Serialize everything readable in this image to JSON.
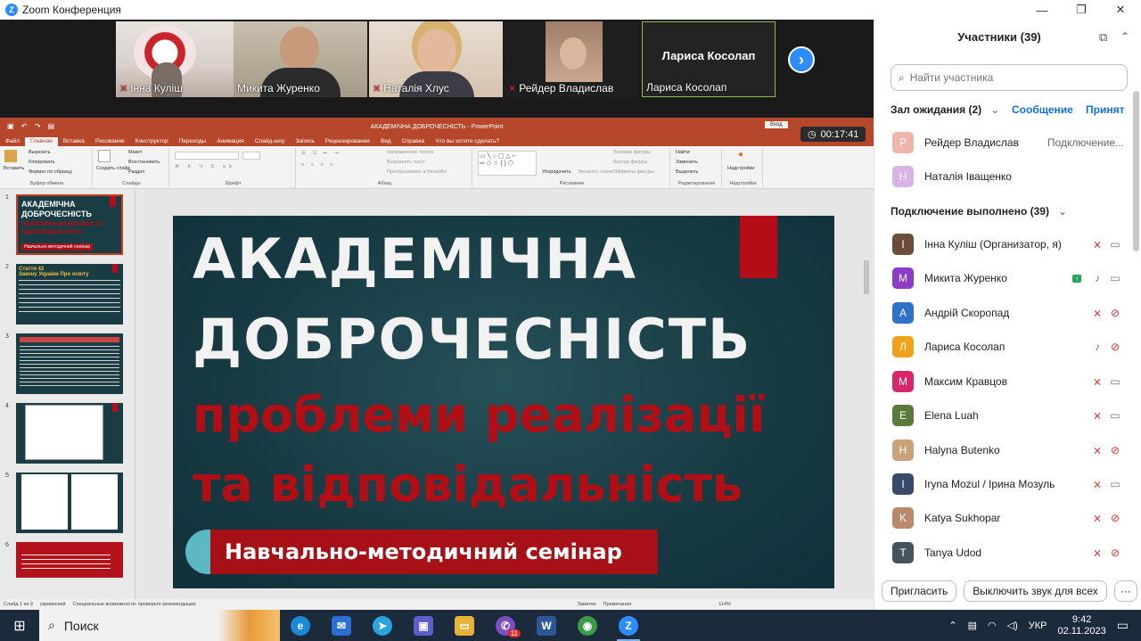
{
  "window": {
    "title": "Zoom Конференция",
    "minimize_icon": "—",
    "maximize_icon": "❐",
    "close_icon": "✕"
  },
  "video_strip": {
    "tiles": [
      {
        "name": "Інна Куліш",
        "muted": true
      },
      {
        "name": "Микита Журенко",
        "muted": false
      },
      {
        "name": "Наталія Хлус",
        "muted": true
      },
      {
        "name": "Рейдер Владислав",
        "muted": true
      },
      {
        "name": "Лариса Косолап",
        "muted": false,
        "big_label": "Лариса Косолап"
      }
    ],
    "next_icon": "›"
  },
  "timer": "00:17:41",
  "powerpoint": {
    "title": "АКАДЕМІЧНА ДОБРОЧЕСНІСТЬ - PowerPoint",
    "signin": "Вход",
    "menu": [
      "Файл",
      "Главная",
      "Вставка",
      "Рисование",
      "Конструктор",
      "Переходы",
      "Анимация",
      "Слайд-шоу",
      "Запись",
      "Рецензирование",
      "Вид",
      "Справка",
      "Что вы хотите сделать?"
    ],
    "active_menu": "Главная",
    "ribbon": {
      "clipboard": {
        "paste": "Вставить",
        "cut": "Вырезать",
        "copy": "Копировать",
        "format": "Формат по образцу",
        "label": "Буфер обмена"
      },
      "slides": {
        "new": "Создать слайд",
        "layout": "Макет",
        "reset": "Восстановить",
        "section": "Раздел",
        "label": "Слайды"
      },
      "font_label": "Шрифт",
      "paragraph": {
        "direction": "Направление текста",
        "align": "Выровнять текст",
        "smartart": "Преобразовать в SmartArt",
        "label": "Абзац"
      },
      "drawing": {
        "arrange": "Упорядочить",
        "styles": "Экспресс-стили",
        "fill": "Заливка фигуры",
        "outline": "Контур фигуры",
        "effects": "Эффекты фигуры",
        "label": "Рисование"
      },
      "editing": {
        "find": "Найти",
        "replace": "Заменить",
        "select": "Выделить",
        "label": "Редактирование"
      },
      "addins": {
        "addins": "Надстройки",
        "label": "Надстройки"
      }
    },
    "thumbnails": [
      {
        "num": "1",
        "title": "АКАДЕМІЧНА ДОБРОЧЕСНІСТЬ",
        "sub": "проблеми реалізації та відповідальність",
        "band": "Навчально-методичний семінар"
      },
      {
        "num": "2",
        "title": "Стаття 42",
        "sub": "Закону України Про освіту"
      },
      {
        "num": "3"
      },
      {
        "num": "4"
      },
      {
        "num": "5"
      },
      {
        "num": "6"
      }
    ],
    "slide": {
      "line1": "АКАДЕМІЧНА",
      "line2": "ДОБРОЧЕСНІСТЬ",
      "line3": "проблеми реалізації",
      "line4": "та відповідальність",
      "band": "Навчально-методичний семінар"
    },
    "status": {
      "slide": "Слайд 1 из 9",
      "lang": "украинский",
      "access": "Специальные возможности: проверьте рекомендации",
      "notes": "Заметки",
      "comments": "Примечания",
      "zoom": "114%"
    }
  },
  "participants": {
    "title": "Участники (39)",
    "search_placeholder": "Найти участника",
    "waiting": {
      "label": "Зал ожидания (2)",
      "message": "Сообщение",
      "admit": "Принят",
      "people": [
        {
          "initial": "Р",
          "name": "Рейдер Владислав",
          "status": "Подключение...",
          "color": "#f0b5a8"
        },
        {
          "initial": "Н",
          "name": "Наталія Іващенко",
          "status": "",
          "color": "#d9b3e6"
        }
      ]
    },
    "connected": {
      "label": "Подключение выполнено (39)",
      "people": [
        {
          "initial": "І",
          "name": "Інна Куліш (Организатор, я)",
          "color": "#6b4e3a",
          "mic": "off",
          "cam": "on"
        },
        {
          "initial": "М",
          "name": "Микита Журенко",
          "color": "#8e3cc7",
          "mic": "on",
          "cam": "on",
          "sharing": true
        },
        {
          "initial": "А",
          "name": "Андрій Скоропад",
          "color": "#2f73c9",
          "mic": "off",
          "cam": "off"
        },
        {
          "initial": "Л",
          "name": "Лариса Косолап",
          "color": "#f0a21b",
          "mic": "on",
          "cam": "off"
        },
        {
          "initial": "М",
          "name": "Максим Кравцов",
          "color": "#d9286a",
          "mic": "off",
          "cam": "on"
        },
        {
          "initial": "E",
          "name": "Elena Luah",
          "color": "#5b7a3a",
          "mic": "off",
          "cam": "on"
        },
        {
          "initial": "H",
          "name": "Halyna Butenko",
          "color": "#c9a27a",
          "mic": "off",
          "cam": "off"
        },
        {
          "initial": "I",
          "name": "Iryna Mozul / Ірина Мозуль",
          "color": "#3a4a6a",
          "mic": "off",
          "cam": "on"
        },
        {
          "initial": "K",
          "name": "Katya Sukhopar",
          "color": "#b88a6a",
          "mic": "off",
          "cam": "off"
        },
        {
          "initial": "T",
          "name": "Tanya Udod",
          "color": "#45535e",
          "mic": "off",
          "cam": "off"
        }
      ]
    },
    "invite": "Пригласить",
    "mute_all": "Выключить звук для всех",
    "more": "···"
  },
  "taskbar": {
    "search": "Поиск",
    "apps": [
      {
        "name": "edge",
        "glyph": "e",
        "color": "#1b8ad6"
      },
      {
        "name": "mail",
        "glyph": "✉",
        "color": "#2a6fd1"
      },
      {
        "name": "telegram",
        "glyph": "➤",
        "color": "#2aa3de"
      },
      {
        "name": "save",
        "glyph": "▣",
        "color": "#5b5fc7"
      },
      {
        "name": "explorer",
        "glyph": "▭",
        "color": "#e8b33a"
      },
      {
        "name": "viber",
        "glyph": "✆",
        "color": "#7d4fc1",
        "badge": "11"
      },
      {
        "name": "word",
        "glyph": "W",
        "color": "#2b5797"
      },
      {
        "name": "chrome",
        "glyph": "◉",
        "color": "#3c9a4a"
      },
      {
        "name": "zoom",
        "glyph": "Z",
        "color": "#2d8cff",
        "active": true
      }
    ],
    "lang": "УКР",
    "time": "9:42",
    "date": "02.11.2023"
  }
}
